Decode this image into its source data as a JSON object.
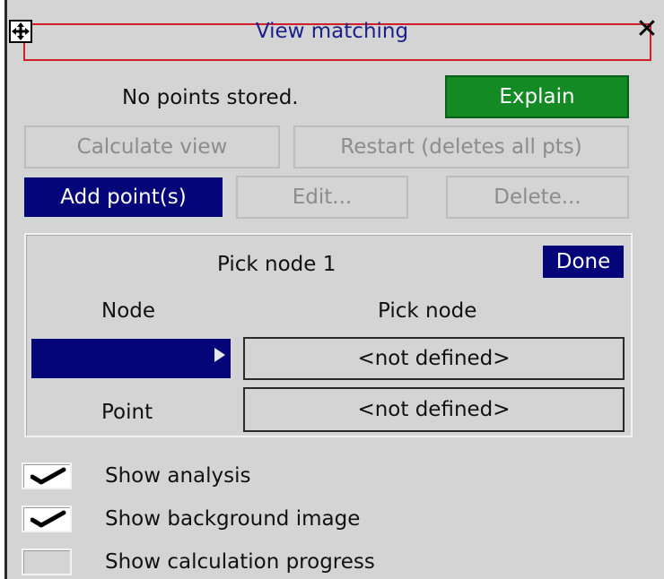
{
  "window": {
    "title": "View matching",
    "move_icon": "move-icon",
    "close_icon": "close-icon",
    "close_glyph": "✕"
  },
  "status": {
    "message": "No points stored."
  },
  "buttons": {
    "explain": "Explain",
    "calculate_view": "Calculate view",
    "restart": "Restart (deletes all pts)",
    "add_points": "Add point(s)",
    "edit": "Edit...",
    "delete": "Delete..."
  },
  "pick_panel": {
    "heading": "Pick node 1",
    "done": "Done",
    "node_label": "Node",
    "pick_node_label": "Pick node",
    "node_value": "",
    "pick_node_value": "<not defined>",
    "point_label": "Point",
    "point_value": "<not defined>"
  },
  "options": [
    {
      "label": "Show analysis",
      "checked": true
    },
    {
      "label": "Show background image",
      "checked": true
    },
    {
      "label": "Show calculation progress",
      "checked": false
    }
  ],
  "colors": {
    "accent_green": "#138a23",
    "navy": "#05057a",
    "title_border": "#d21d2b",
    "title_text": "#1b1f8a",
    "background": "#d4d4d4"
  }
}
